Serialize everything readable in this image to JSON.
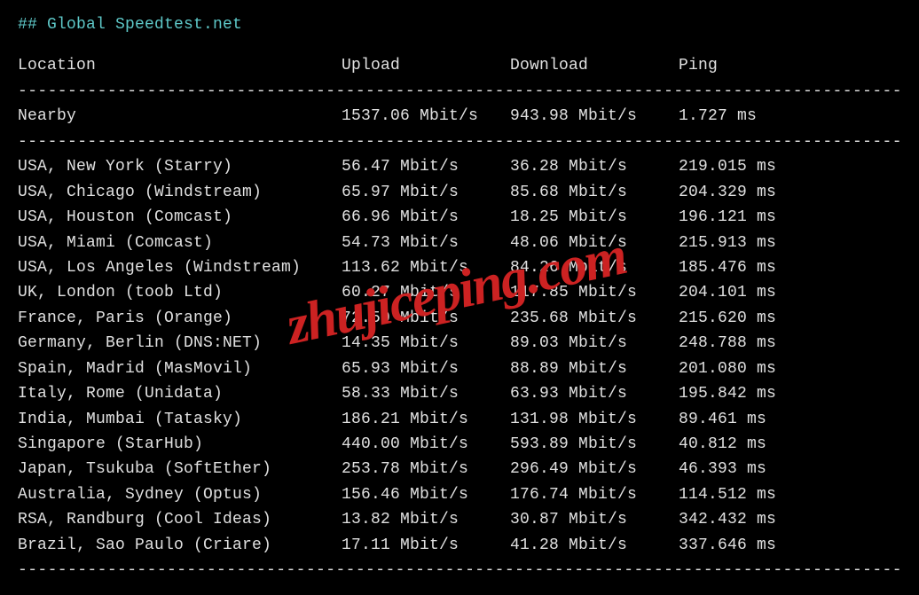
{
  "title_prefix": "## ",
  "title": "Global Speedtest.net",
  "headers": {
    "location": "Location",
    "upload": "Upload",
    "download": "Download",
    "ping": "Ping"
  },
  "divider": "-----------------------------------------------------------------------------------------",
  "nearby": {
    "location": "Nearby",
    "upload": "1537.06 Mbit/s",
    "download": "943.98 Mbit/s",
    "ping": "1.727 ms"
  },
  "rows": [
    {
      "location": "USA, New York (Starry)",
      "upload": "56.47 Mbit/s",
      "download": "36.28 Mbit/s",
      "ping": "219.015 ms"
    },
    {
      "location": "USA, Chicago (Windstream)",
      "upload": "65.97 Mbit/s",
      "download": "85.68 Mbit/s",
      "ping": "204.329 ms"
    },
    {
      "location": "USA, Houston (Comcast)",
      "upload": "66.96 Mbit/s",
      "download": "18.25 Mbit/s",
      "ping": "196.121 ms"
    },
    {
      "location": "USA, Miami (Comcast)",
      "upload": "54.73 Mbit/s",
      "download": "48.06 Mbit/s",
      "ping": "215.913 ms"
    },
    {
      "location": "USA, Los Angeles (Windstream)",
      "upload": "113.62 Mbit/s",
      "download": "84.26 Mbit/s",
      "ping": "185.476 ms"
    },
    {
      "location": "UK, London (toob Ltd)",
      "upload": "60.27 Mbit/s",
      "download": "117.85 Mbit/s",
      "ping": "204.101 ms"
    },
    {
      "location": "France, Paris (Orange)",
      "upload": "72.50 Mbit/s",
      "download": "235.68 Mbit/s",
      "ping": "215.620 ms"
    },
    {
      "location": "Germany, Berlin (DNS:NET)",
      "upload": "14.35 Mbit/s",
      "download": "89.03 Mbit/s",
      "ping": "248.788 ms"
    },
    {
      "location": "Spain, Madrid (MasMovil)",
      "upload": "65.93 Mbit/s",
      "download": "88.89 Mbit/s",
      "ping": "201.080 ms"
    },
    {
      "location": "Italy, Rome (Unidata)",
      "upload": "58.33 Mbit/s",
      "download": "63.93 Mbit/s",
      "ping": "195.842 ms"
    },
    {
      "location": "India, Mumbai (Tatasky)",
      "upload": "186.21 Mbit/s",
      "download": "131.98 Mbit/s",
      "ping": "89.461 ms"
    },
    {
      "location": "Singapore (StarHub)",
      "upload": "440.00 Mbit/s",
      "download": "593.89 Mbit/s",
      "ping": "40.812 ms"
    },
    {
      "location": "Japan, Tsukuba (SoftEther)",
      "upload": "253.78 Mbit/s",
      "download": "296.49 Mbit/s",
      "ping": "46.393 ms"
    },
    {
      "location": "Australia, Sydney (Optus)",
      "upload": "156.46 Mbit/s",
      "download": "176.74 Mbit/s",
      "ping": "114.512 ms"
    },
    {
      "location": "RSA, Randburg (Cool Ideas)",
      "upload": "13.82 Mbit/s",
      "download": "30.87 Mbit/s",
      "ping": "342.432 ms"
    },
    {
      "location": "Brazil, Sao Paulo (Criare)",
      "upload": "17.11 Mbit/s",
      "download": "41.28 Mbit/s",
      "ping": "337.646 ms"
    }
  ],
  "watermark": "zhujiceping.com"
}
